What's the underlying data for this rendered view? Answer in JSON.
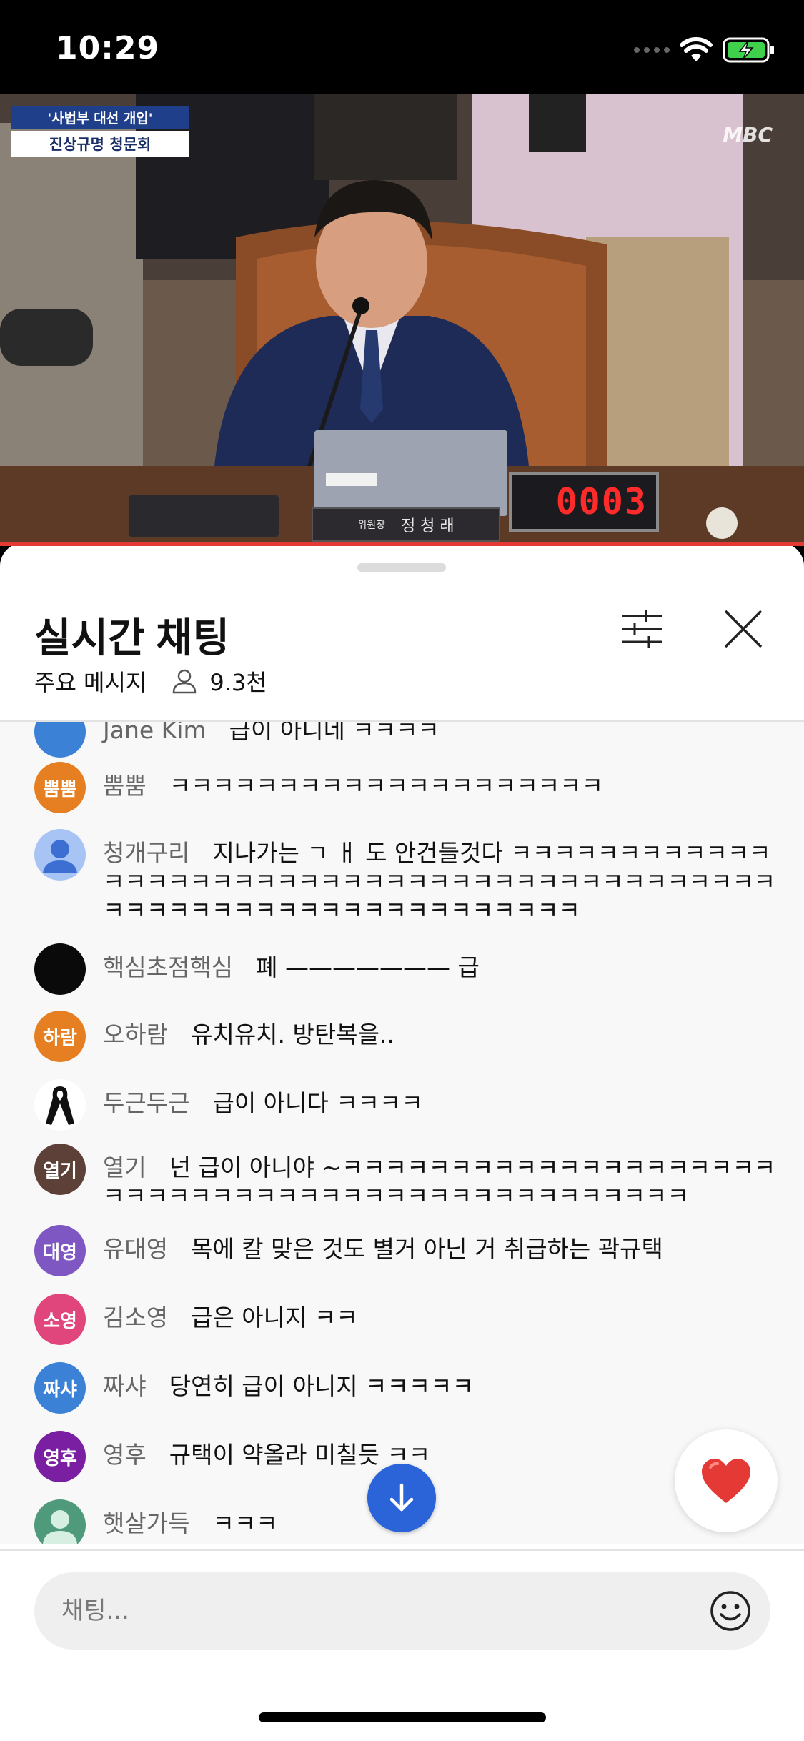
{
  "status_bar": {
    "time": "10:29",
    "battery_charging": true
  },
  "video": {
    "banner_line1": "'사법부 대선 개입'",
    "banner_line2": "진상규명 청문회",
    "broadcaster": "MBC",
    "nameplate_title": "위원장",
    "nameplate_name": "정 청 래",
    "timer": "0003"
  },
  "chat": {
    "title": "실시간 채팅",
    "mode": "주요 메시지",
    "viewer_count": "9.3천",
    "input_placeholder": "채팅...",
    "messages": [
      {
        "initials": "",
        "color": "#3b82d6",
        "author": "Jane Kim",
        "text": "급이 아니네 ㅋㅋㅋㅋ"
      },
      {
        "initials": "뿜뿜",
        "color": "#e67e22",
        "author": "뿜뿜",
        "text": "ㅋㅋㅋㅋㅋㅋㅋㅋㅋㅋㅋㅋㅋㅋㅋㅋㅋㅋㅋㅋ"
      },
      {
        "initials": "",
        "color": "#a8c4f5",
        "author": "청개구리",
        "text": "지나가는 ㄱ ㅐ 도 안건들것다 ㅋㅋㅋㅋㅋㅋㅋㅋㅋㅋㅋㅋㅋㅋㅋㅋㅋㅋㅋㅋㅋㅋㅋㅋㅋㅋㅋㅋㅋㅋㅋㅋㅋㅋㅋㅋㅋㅋㅋㅋㅋㅋㅋㅋㅋㅋㅋㅋㅋㅋㅋㅋㅋㅋㅋㅋㅋㅋㅋㅋㅋㅋㅋㅋㅋ"
      },
      {
        "initials": "",
        "color": "#0a0a0a",
        "author": "핵심초점핵심",
        "text": "폐 ——————— 급"
      },
      {
        "initials": "하람",
        "color": "#e67e22",
        "author": "오하람",
        "text": "유치유치. 방탄복을.."
      },
      {
        "initials": "",
        "color": "#ffffff",
        "author": "두근두근",
        "text": "급이 아니다 ㅋㅋㅋㅋ"
      },
      {
        "initials": "열기",
        "color": "#5d4037",
        "author": "열기",
        "text": "넌 급이 아니야 ~ㅋㅋㅋㅋㅋㅋㅋㅋㅋㅋㅋㅋㅋㅋㅋㅋㅋㅋㅋㅋㅋㅋㅋㅋㅋㅋㅋㅋㅋㅋㅋㅋㅋㅋㅋㅋㅋㅋㅋㅋㅋㅋㅋㅋㅋㅋㅋ"
      },
      {
        "initials": "대영",
        "color": "#7e57c2",
        "author": "유대영",
        "text": "목에 칼 맞은 것도 별거 아닌 거 취급하는 곽규택"
      },
      {
        "initials": "소영",
        "color": "#e0457b",
        "author": "김소영",
        "text": "급은 아니지 ㅋㅋ"
      },
      {
        "initials": "짜샤",
        "color": "#3b82d6",
        "author": "짜샤",
        "text": "당연히 급이 아니지 ㅋㅋㅋㅋㅋ"
      },
      {
        "initials": "영후",
        "color": "#7b1fa2",
        "author": "영후",
        "text": "규택이 약올라 미칠듯 ㅋㅋ"
      },
      {
        "initials": "",
        "color": "#4e9a7a",
        "author": "햇살가득",
        "text": "ㅋㅋㅋ"
      }
    ]
  },
  "colors": {
    "accent": "#2b63d8",
    "progress": "#e53935",
    "heart": "#e53935"
  }
}
